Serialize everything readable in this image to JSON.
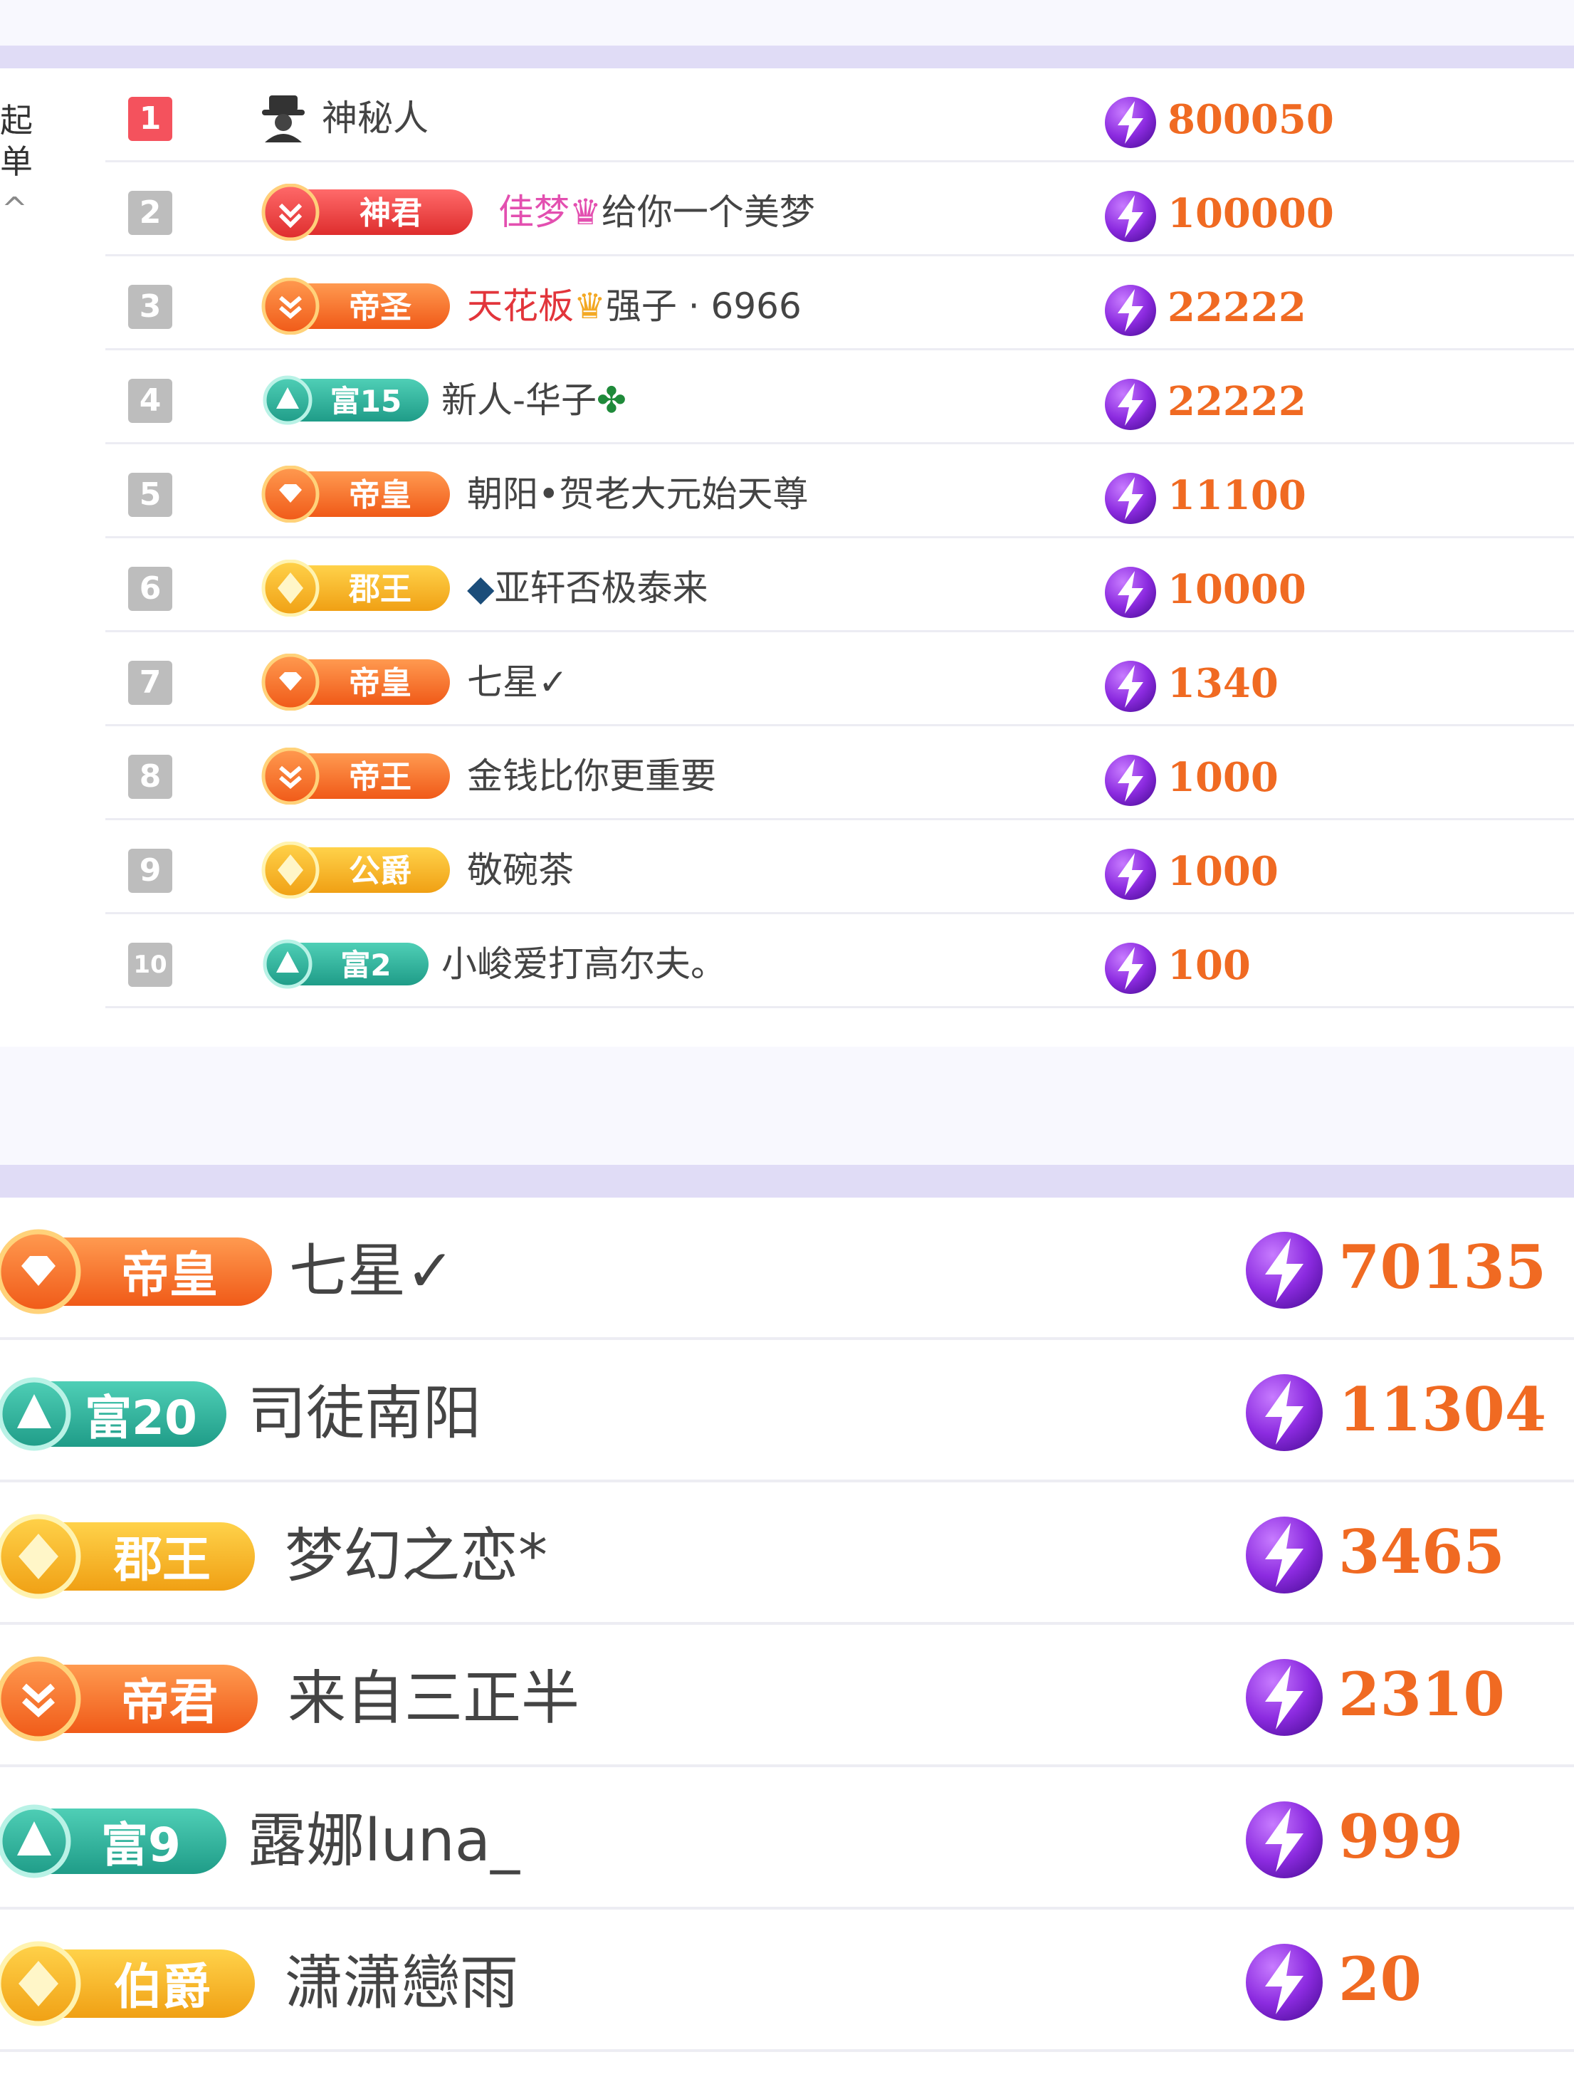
{
  "sidebar": {
    "collapse_label_line1": "收起",
    "collapse_label_line2": "榜单",
    "collapse_arrow": "^"
  },
  "colors": {
    "score": "#f06a22",
    "divider": "#e0dcf6",
    "rank_top": "#f4525d",
    "rank_default": "#bdbdbd",
    "badge_orange": "#f26a2a",
    "badge_gold": "#f3a823",
    "badge_green": "#2cae9a",
    "name_pink": "#e34fb0",
    "name_red": "#e2353b"
  },
  "ranking": {
    "rows": [
      {
        "rank": "1",
        "badge": null,
        "name": "神秘人",
        "score": "800050",
        "icon": "spy-icon"
      },
      {
        "rank": "2",
        "badge": {
          "label": "神君",
          "color": "red"
        },
        "name_prefix": "佳梦",
        "name": "给你一个美梦",
        "score": "100000",
        "icon": "crown-icon"
      },
      {
        "rank": "3",
        "badge": {
          "label": "帝圣",
          "color": "orange"
        },
        "name_prefix": "天花板",
        "name": "强子 · 6966",
        "score": "22222",
        "icon": "crown-icon"
      },
      {
        "rank": "4",
        "badge": {
          "label": "富15",
          "color": "green"
        },
        "name": "新人-华子",
        "score": "22222",
        "icon": "clover-icon"
      },
      {
        "rank": "5",
        "badge": {
          "label": "帝皇",
          "color": "orange"
        },
        "name": "朝阳•贺老大元始天尊",
        "score": "11100"
      },
      {
        "rank": "6",
        "badge": {
          "label": "郡王",
          "color": "gold"
        },
        "name": "亚轩否极泰来",
        "score": "10000",
        "icon": "fish-icon"
      },
      {
        "rank": "7",
        "badge": {
          "label": "帝皇",
          "color": "orange"
        },
        "name": "七星✓",
        "score": "1340"
      },
      {
        "rank": "8",
        "badge": {
          "label": "帝王",
          "color": "orange"
        },
        "name": "金钱比你更重要",
        "score": "1000"
      },
      {
        "rank": "9",
        "badge": {
          "label": "公爵",
          "color": "gold"
        },
        "name": "敬碗茶",
        "score": "1000"
      },
      {
        "rank": "10",
        "badge": {
          "label": "富2",
          "color": "green"
        },
        "name": "小峻爱打高尔夫。",
        "score": "100"
      }
    ]
  },
  "contributors": {
    "rows": [
      {
        "badge": {
          "label": "帝皇",
          "color": "orange"
        },
        "name": "七星✓",
        "score": "70135"
      },
      {
        "badge": {
          "label": "富20",
          "color": "green"
        },
        "name": "司徒南阳",
        "score": "11304"
      },
      {
        "badge": {
          "label": "郡王",
          "color": "gold"
        },
        "name": "梦幻之恋*",
        "score": "3465"
      },
      {
        "badge": {
          "label": "帝君",
          "color": "orange"
        },
        "name": "来自三正半",
        "score": "2310"
      },
      {
        "badge": {
          "label": "富9",
          "color": "green"
        },
        "name": "露娜luna_",
        "score": "999"
      },
      {
        "badge": {
          "label": "伯爵",
          "color": "gold"
        },
        "name": "潇潇戀雨",
        "score": "20"
      }
    ]
  }
}
